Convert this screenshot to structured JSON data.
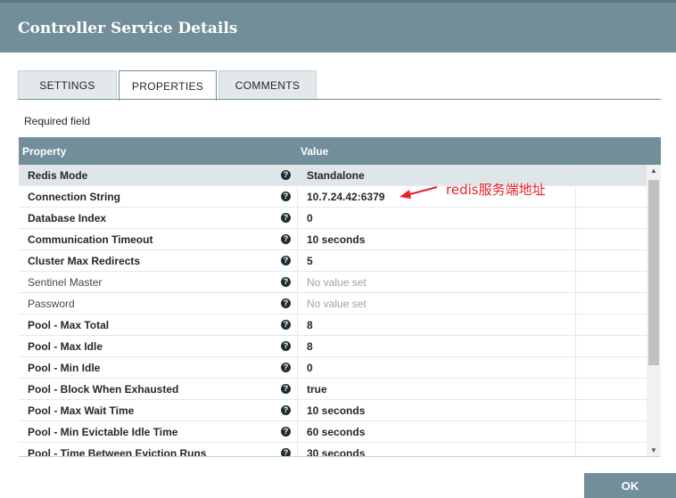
{
  "dialog": {
    "title": "Controller Service Details"
  },
  "tabs": [
    {
      "label": "SETTINGS"
    },
    {
      "label": "PROPERTIES"
    },
    {
      "label": "COMMENTS"
    }
  ],
  "required_label": "Required field",
  "grid": {
    "columns": {
      "property": "Property",
      "value": "Value"
    },
    "rows": [
      {
        "property": "Redis Mode",
        "value": "Standalone",
        "required": true,
        "selected": true
      },
      {
        "property": "Connection String",
        "value": "10.7.24.42:6379",
        "required": true
      },
      {
        "property": "Database Index",
        "value": "0",
        "required": true
      },
      {
        "property": "Communication Timeout",
        "value": "10 seconds",
        "required": true
      },
      {
        "property": "Cluster Max Redirects",
        "value": "5",
        "required": true
      },
      {
        "property": "Sentinel Master",
        "value": "No value set",
        "required": false,
        "empty": true
      },
      {
        "property": "Password",
        "value": "No value set",
        "required": false,
        "empty": true
      },
      {
        "property": "Pool - Max Total",
        "value": "8",
        "required": true
      },
      {
        "property": "Pool - Max Idle",
        "value": "8",
        "required": true
      },
      {
        "property": "Pool - Min Idle",
        "value": "0",
        "required": true
      },
      {
        "property": "Pool - Block When Exhausted",
        "value": "true",
        "required": true
      },
      {
        "property": "Pool - Max Wait Time",
        "value": "10 seconds",
        "required": true
      },
      {
        "property": "Pool - Min Evictable Idle Time",
        "value": "60 seconds",
        "required": true
      },
      {
        "property": "Pool - Time Between Eviction Runs",
        "value": "30 seconds",
        "required": true
      }
    ],
    "help_icon_glyph": "?"
  },
  "annotation": {
    "text": "redis服务端地址",
    "color": "#e8202a"
  },
  "footer": {
    "ok_label": "OK"
  },
  "colors": {
    "header": "#728e9b",
    "tab_inactive": "#e3e8eb",
    "selected_row": "#dfe6ea"
  }
}
